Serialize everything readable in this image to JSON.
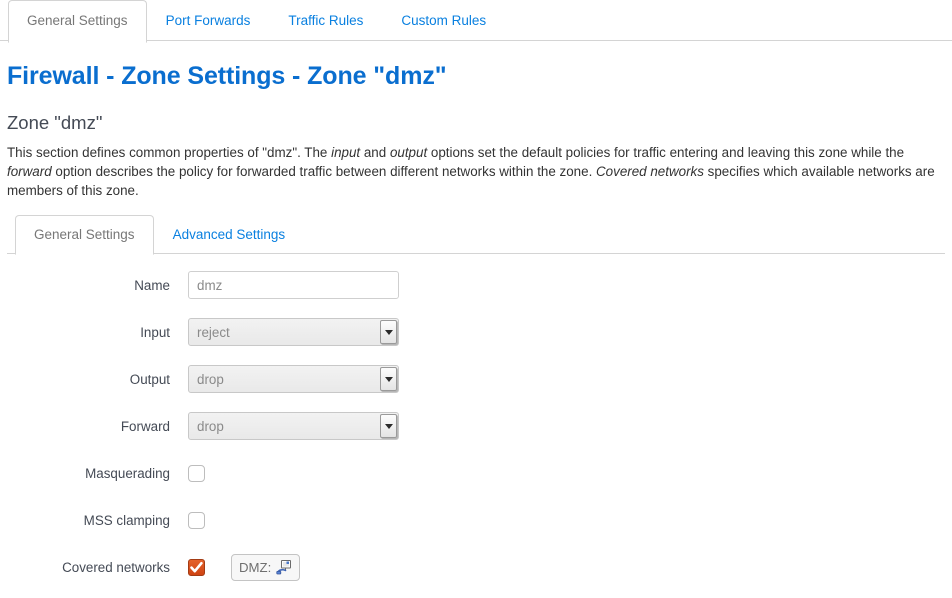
{
  "top_tabs": [
    {
      "label": "General Settings",
      "active": true
    },
    {
      "label": "Port Forwards",
      "active": false
    },
    {
      "label": "Traffic Rules",
      "active": false
    },
    {
      "label": "Custom Rules",
      "active": false
    }
  ],
  "page": {
    "title": "Firewall - Zone Settings - Zone \"dmz\"",
    "section_title": "Zone \"dmz\"",
    "description": {
      "part1": "This section defines common properties of \"dmz\". The ",
      "em1": "input",
      "part2": " and ",
      "em2": "output",
      "part3": " options set the default policies for traffic entering and leaving this zone while the ",
      "em3": "forward",
      "part4": " option describes the policy for forwarded traffic between different networks within the zone. ",
      "em4": "Covered networks",
      "part5": " specifies which available networks are members of this zone."
    }
  },
  "inner_tabs": [
    {
      "label": "General Settings",
      "active": true
    },
    {
      "label": "Advanced Settings",
      "active": false
    }
  ],
  "form": {
    "name": {
      "label": "Name",
      "value": "dmz",
      "placeholder": "dmz"
    },
    "input": {
      "label": "Input",
      "value": "reject"
    },
    "output": {
      "label": "Output",
      "value": "drop"
    },
    "forward": {
      "label": "Forward",
      "value": "drop"
    },
    "masquerading": {
      "label": "Masquerading",
      "checked": false
    },
    "mss_clamping": {
      "label": "MSS clamping",
      "checked": false
    },
    "covered_networks": {
      "label": "Covered networks",
      "checked": true,
      "network_badge": {
        "label": "DMZ:",
        "icon": "ethernet-icon"
      }
    }
  },
  "icons": {
    "dropdown": "chevron-down-icon",
    "checkmark": "check-icon"
  },
  "colors": {
    "link": "#0a80e0",
    "title": "#0a6ecf",
    "checkbox_checked": "#d54e21",
    "border": "#d4d4d4",
    "text": "#444a55"
  }
}
